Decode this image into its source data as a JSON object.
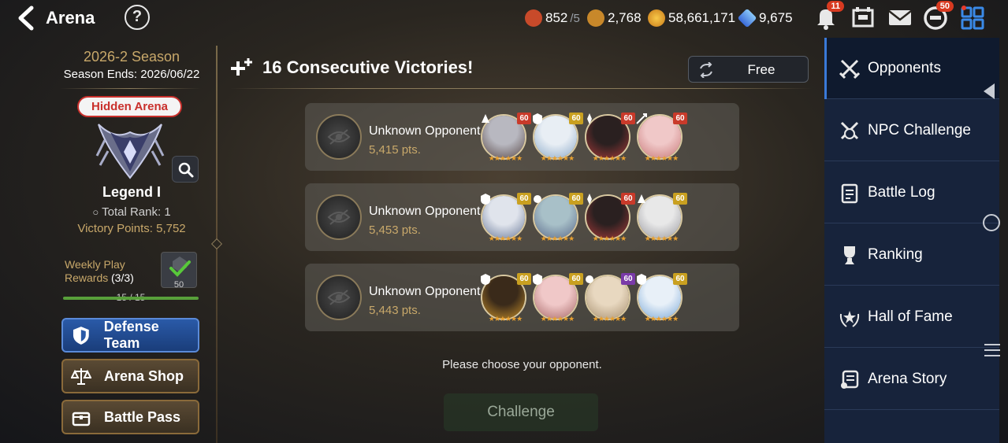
{
  "header": {
    "title": "Arena",
    "resources": [
      {
        "name": "flag-icon",
        "value": "852",
        "sub": "/5"
      },
      {
        "name": "skystone-crest-icon",
        "value": "2,768",
        "sub": ""
      },
      {
        "name": "gold-coin-icon",
        "value": "58,661,171",
        "sub": ""
      },
      {
        "name": "crystal-icon",
        "value": "9,675",
        "sub": ""
      }
    ],
    "notifications_badge": "11",
    "chat_badge": "50"
  },
  "season": {
    "name": "2026-2 Season",
    "ends": "Season Ends: 2026/06/22",
    "tier_tag": "Hidden Arena",
    "rank_name": "Legend I",
    "total_rank": "Total Rank: 1",
    "victory_points": "Victory Points: 5,752",
    "weekly_label": "Weekly Play Rewards",
    "weekly_count": "(3/3)",
    "reward_amount": "50",
    "progress_text": "15 / 15",
    "progress_fraction": 1.0
  },
  "left_buttons": {
    "defense": "Defense Team",
    "shop": "Arena Shop",
    "pass": "Battle Pass"
  },
  "main": {
    "streak": "16 Consecutive Victories!",
    "refresh_label": "Free",
    "choose_text": "Please choose your opponent.",
    "challenge_label": "Challenge",
    "opponents": [
      {
        "name": "Unknown Opponent",
        "points": "5,415 pts.",
        "heroes": [
          {
            "level": "60",
            "lvl_color": "#c93a2a",
            "colors": [
              "#b8b8c0",
              "#5a4a4a"
            ],
            "cls": "mage"
          },
          {
            "level": "60",
            "lvl_color": "#c9a020",
            "colors": [
              "#e8eef4",
              "#8aa8c8"
            ],
            "cls": "knight"
          },
          {
            "level": "60",
            "lvl_color": "#c93a2a",
            "colors": [
              "#2a2020",
              "#a83a3a"
            ],
            "cls": "assassin"
          },
          {
            "level": "60",
            "lvl_color": "#c93a2a",
            "colors": [
              "#f0c8c8",
              "#c87878"
            ],
            "cls": "ranger"
          }
        ]
      },
      {
        "name": "Unknown Opponent",
        "points": "5,453 pts.",
        "heroes": [
          {
            "level": "60",
            "lvl_color": "#c9a020",
            "colors": [
              "#e0e4ec",
              "#6a7a9a"
            ],
            "cls": "knight"
          },
          {
            "level": "60",
            "lvl_color": "#c9a020",
            "colors": [
              "#a8c0c8",
              "#5a6a8a"
            ],
            "cls": "soul-weaver"
          },
          {
            "level": "60",
            "lvl_color": "#c93a2a",
            "colors": [
              "#2a2020",
              "#a83a3a"
            ],
            "cls": "assassin"
          },
          {
            "level": "60",
            "lvl_color": "#c9a020",
            "colors": [
              "#e8e8e8",
              "#9a9aa0"
            ],
            "cls": "mage"
          }
        ]
      },
      {
        "name": "Unknown Opponent",
        "points": "5,443 pts.",
        "heroes": [
          {
            "level": "60",
            "lvl_color": "#c9a020",
            "colors": [
              "#3a2a1a",
              "#c8902a"
            ],
            "cls": "knight"
          },
          {
            "level": "60",
            "lvl_color": "#c9a020",
            "colors": [
              "#f0c8c8",
              "#a86868"
            ],
            "cls": "knight"
          },
          {
            "level": "60",
            "lvl_color": "#7a3aa8",
            "colors": [
              "#e8d8c0",
              "#a89070"
            ],
            "cls": "soul-weaver"
          },
          {
            "level": "60",
            "lvl_color": "#c9a020",
            "colors": [
              "#e8f0f8",
              "#7aa8d8"
            ],
            "cls": "knight"
          }
        ]
      }
    ]
  },
  "sidebar": {
    "items": [
      {
        "label": "Opponents",
        "icon": "crossed-swords-icon"
      },
      {
        "label": "NPC Challenge",
        "icon": "npc-swords-icon"
      },
      {
        "label": "Battle Log",
        "icon": "clipboard-icon"
      },
      {
        "label": "Ranking",
        "icon": "trophy-icon"
      },
      {
        "label": "Hall of Fame",
        "icon": "laurel-star-icon"
      },
      {
        "label": "Arena Story",
        "icon": "scroll-icon"
      }
    ]
  }
}
